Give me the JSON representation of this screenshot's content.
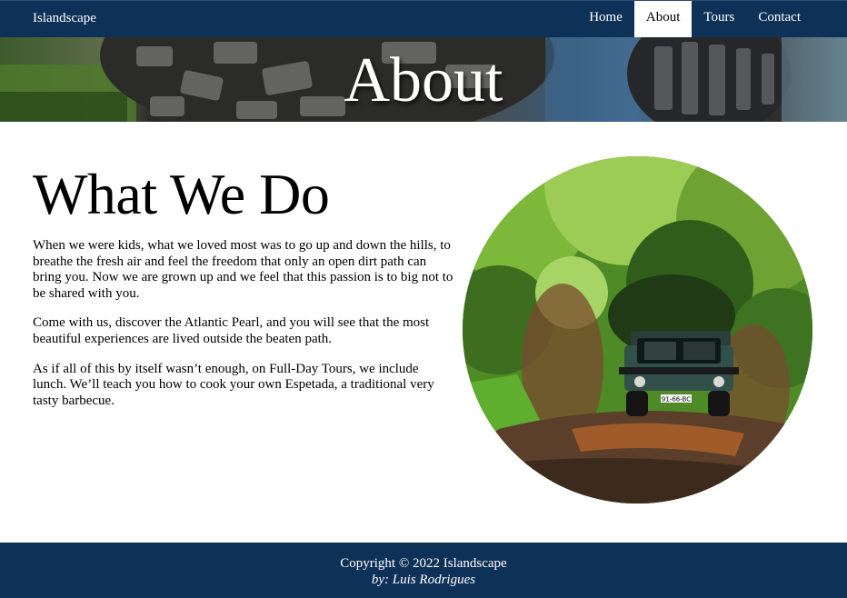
{
  "nav": {
    "brand": "Islandscape",
    "links": [
      {
        "label": "Home",
        "active": false
      },
      {
        "label": "About",
        "active": true
      },
      {
        "label": "Tours",
        "active": false
      },
      {
        "label": "Contact",
        "active": false
      }
    ]
  },
  "hero": {
    "title": "About"
  },
  "main": {
    "heading": "What We Do",
    "paragraphs": [
      "When we were kids, what we loved most was to go up and down the hills, to breathe the fresh air and feel the freedom that only an open dirt path can bring you. Now we are grown up and we feel that this passion is to big not to be shared with you.",
      "Come with us, discover the Atlantic Pearl, and you will see that the most beautiful experiences are lived outside the beaten path.",
      "As if all of this by itself wasn’t enough, on Full-Day Tours, we include lunch. We’ll teach you how to cook your own Espetada, a traditional very tasty barbecue."
    ],
    "photo_plate": "91-66-BC"
  },
  "footer": {
    "copyright": "Copyright © 2022 Islandscape",
    "author": "by: Luis Rodrigues"
  },
  "colors": {
    "nav_bg": "#0e3158",
    "footer_bg": "#0e3158",
    "text": "#000000",
    "background": "#ffffff"
  }
}
